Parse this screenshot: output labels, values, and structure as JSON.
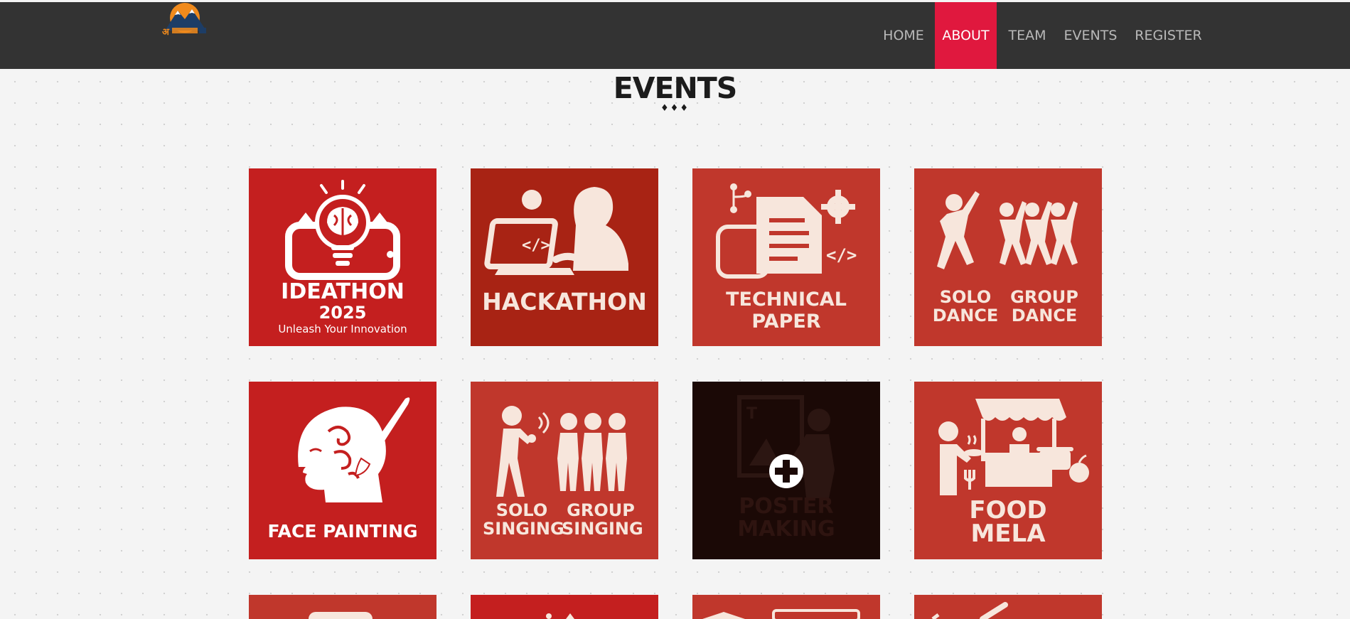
{
  "site": {
    "logo_text": "अ"
  },
  "nav": {
    "items": [
      {
        "label": "HOME",
        "active": false
      },
      {
        "label": "ABOUT",
        "active": true
      },
      {
        "label": "TEAM",
        "active": false
      },
      {
        "label": "EVENTS",
        "active": false
      },
      {
        "label": "REGISTER",
        "active": false
      }
    ]
  },
  "section": {
    "title": "EVENTS",
    "decoration": "♦♦♦"
  },
  "events": [
    {
      "title": "IDEATHON",
      "year": "2025",
      "tagline": "Unleash Your Innovation",
      "icon": "lightbulb-brain-icon",
      "color": "#c41f1f"
    },
    {
      "title": "HACKATHON",
      "icon": "coder-laptop-icon",
      "color": "#a82314"
    },
    {
      "title_line1": "TECHNICAL",
      "title_line2": "PAPER",
      "icon": "document-code-icon",
      "color": "#c0372c"
    },
    {
      "left_line1": "SOLO",
      "left_line2": "DANCE",
      "right_line1": "GROUP",
      "right_line2": "DANCE",
      "icon": "dancers-icon",
      "color": "#c0372c"
    },
    {
      "title": "FACE PAINTING",
      "icon": "painted-face-icon",
      "color": "#c41f1f"
    },
    {
      "left_line1": "SOLO",
      "left_line2": "SINGING",
      "right_line1": "GROUP",
      "right_line2": "SINGING",
      "icon": "singers-icon",
      "color": "#c0372c"
    },
    {
      "title_line1": "POSTER",
      "title_line2": "MAKING",
      "icon": "poster-painter-icon",
      "color": "#1b0906",
      "hover_icon": "plus-circle-icon"
    },
    {
      "title_line1": "FOOD",
      "title_line2": "MELA",
      "icon": "food-stall-icon",
      "color": "#c0372c"
    }
  ]
}
